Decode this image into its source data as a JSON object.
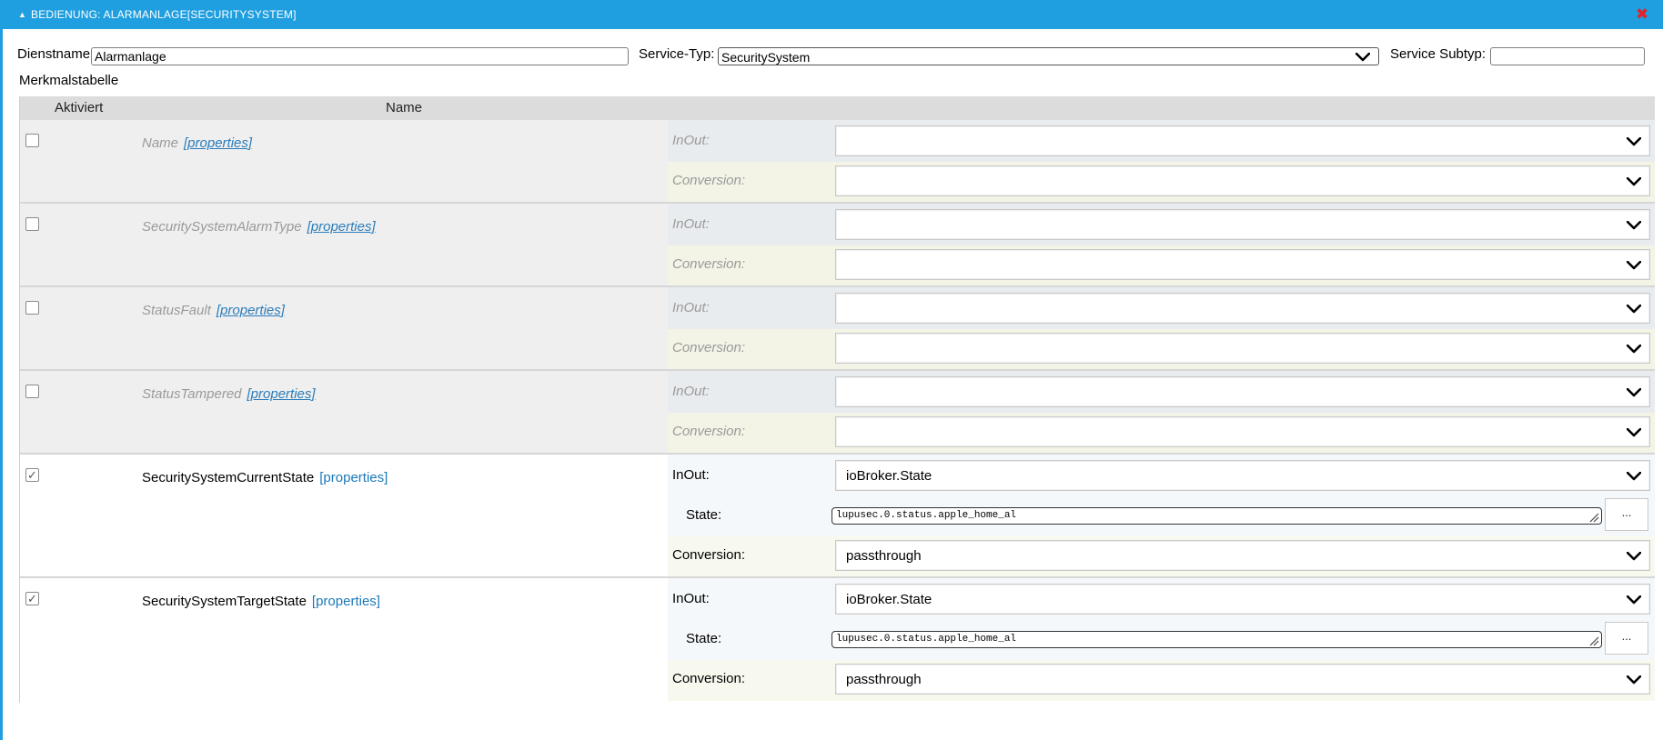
{
  "window": {
    "title": "BEDIENUNG: ALARMANLAGE[SECURITYSYSTEM]",
    "collapse_glyph": "▲",
    "close_glyph": "✖",
    "accent_color": "#1f9fe0",
    "close_color": "#e0242b"
  },
  "form": {
    "service_name_label": "Dienstname:",
    "service_name_value": "Alarmanlage",
    "service_type_label": "Service-Typ:",
    "service_type_value": "SecuritySystem",
    "service_subtype_label": "Service Subtyp:",
    "service_subtype_value": "",
    "table_label": "Merkmalstabelle"
  },
  "table": {
    "header_activated": "Aktiviert",
    "header_name": "Name",
    "properties_link": "[properties]",
    "inout_label": "InOut:",
    "conversion_label": "Conversion:",
    "state_label": "State:",
    "dots_label": "...",
    "rows": [
      {
        "name": "Name",
        "active": false,
        "inout": "",
        "conversion": ""
      },
      {
        "name": "SecuritySystemAlarmType",
        "active": false,
        "inout": "",
        "conversion": ""
      },
      {
        "name": "StatusFault",
        "active": false,
        "inout": "",
        "conversion": ""
      },
      {
        "name": "StatusTampered",
        "active": false,
        "inout": "",
        "conversion": ""
      },
      {
        "name": "SecuritySystemCurrentState",
        "active": true,
        "inout": "ioBroker.State",
        "state": "lupusec.0.status.apple_home_al",
        "conversion": "passthrough"
      },
      {
        "name": "SecuritySystemTargetState",
        "active": true,
        "inout": "ioBroker.State",
        "state": "lupusec.0.status.apple_home_al",
        "conversion": "passthrough"
      }
    ]
  }
}
